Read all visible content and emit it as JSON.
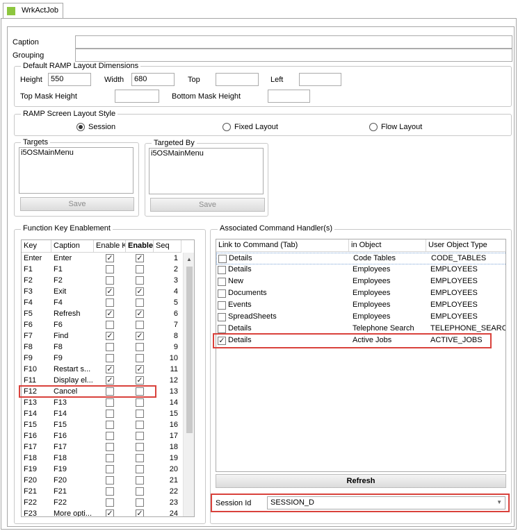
{
  "tab": {
    "label": "WrkActJob"
  },
  "caption": {
    "label": "Caption",
    "value": ""
  },
  "grouping": {
    "label": "Grouping",
    "value": ""
  },
  "dims": {
    "title": "Default RAMP Layout Dimensions",
    "height_label": "Height",
    "height": "550",
    "width_label": "Width",
    "width": "680",
    "top_label": "Top",
    "top": "",
    "left_label": "Left",
    "left": "",
    "topmask_label": "Top Mask Height",
    "topmask": "",
    "bottommask_label": "Bottom Mask Height",
    "bottommask": ""
  },
  "style": {
    "title": "RAMP Screen Layout Style",
    "options": [
      "Session",
      "Fixed Layout",
      "Flow Layout"
    ],
    "selected": "Session"
  },
  "targets": {
    "title": "Targets",
    "items": [
      "i5OSMainMenu"
    ],
    "save": "Save"
  },
  "targeted_by": {
    "title": "Targeted By",
    "items": [
      "i5OSMainMenu"
    ],
    "save": "Save"
  },
  "fke": {
    "title": "Function Key Enablement",
    "headers": [
      "Key",
      "Caption",
      "Enable Ke",
      "Enable",
      "Seq"
    ],
    "rows": [
      {
        "key": "Enter",
        "caption": "Enter",
        "a": true,
        "b": true,
        "seq": "1"
      },
      {
        "key": "F1",
        "caption": "F1",
        "a": false,
        "b": false,
        "seq": "2"
      },
      {
        "key": "F2",
        "caption": "F2",
        "a": false,
        "b": false,
        "seq": "3"
      },
      {
        "key": "F3",
        "caption": "Exit",
        "a": true,
        "b": true,
        "seq": "4"
      },
      {
        "key": "F4",
        "caption": "F4",
        "a": false,
        "b": false,
        "seq": "5"
      },
      {
        "key": "F5",
        "caption": "Refresh",
        "a": true,
        "b": true,
        "seq": "6"
      },
      {
        "key": "F6",
        "caption": "F6",
        "a": false,
        "b": false,
        "seq": "7"
      },
      {
        "key": "F7",
        "caption": "Find",
        "a": true,
        "b": true,
        "seq": "8"
      },
      {
        "key": "F8",
        "caption": "F8",
        "a": false,
        "b": false,
        "seq": "9"
      },
      {
        "key": "F9",
        "caption": "F9",
        "a": false,
        "b": false,
        "seq": "10"
      },
      {
        "key": "F10",
        "caption": "Restart s...",
        "a": true,
        "b": true,
        "seq": "11"
      },
      {
        "key": "F11",
        "caption": "Display el...",
        "a": true,
        "b": true,
        "seq": "12"
      },
      {
        "key": "F12",
        "caption": "Cancel",
        "a": false,
        "b": false,
        "seq": "13"
      },
      {
        "key": "F13",
        "caption": "F13",
        "a": false,
        "b": false,
        "seq": "14"
      },
      {
        "key": "F14",
        "caption": "F14",
        "a": false,
        "b": false,
        "seq": "15"
      },
      {
        "key": "F15",
        "caption": "F15",
        "a": false,
        "b": false,
        "seq": "16"
      },
      {
        "key": "F16",
        "caption": "F16",
        "a": false,
        "b": false,
        "seq": "17"
      },
      {
        "key": "F17",
        "caption": "F17",
        "a": false,
        "b": false,
        "seq": "18"
      },
      {
        "key": "F18",
        "caption": "F18",
        "a": false,
        "b": false,
        "seq": "19"
      },
      {
        "key": "F19",
        "caption": "F19",
        "a": false,
        "b": false,
        "seq": "20"
      },
      {
        "key": "F20",
        "caption": "F20",
        "a": false,
        "b": false,
        "seq": "21"
      },
      {
        "key": "F21",
        "caption": "F21",
        "a": false,
        "b": false,
        "seq": "22"
      },
      {
        "key": "F22",
        "caption": "F22",
        "a": false,
        "b": false,
        "seq": "23"
      },
      {
        "key": "F23",
        "caption": "More opti...",
        "a": true,
        "b": true,
        "seq": "24"
      }
    ]
  },
  "ach": {
    "title": "Associated Command Handler(s)",
    "headers": [
      "Link to Command (Tab)",
      "in Object",
      "User Object Type"
    ],
    "rows": [
      {
        "checked": false,
        "cmd": "Details",
        "obj": "Code Tables",
        "type": "CODE_TABLES"
      },
      {
        "checked": false,
        "cmd": "Details",
        "obj": "Employees",
        "type": "EMPLOYEES"
      },
      {
        "checked": false,
        "cmd": "New",
        "obj": "Employees",
        "type": "EMPLOYEES"
      },
      {
        "checked": false,
        "cmd": "Documents",
        "obj": "Employees",
        "type": "EMPLOYEES"
      },
      {
        "checked": false,
        "cmd": "Events",
        "obj": "Employees",
        "type": "EMPLOYEES"
      },
      {
        "checked": false,
        "cmd": "SpreadSheets",
        "obj": "Employees",
        "type": "EMPLOYEES"
      },
      {
        "checked": false,
        "cmd": "Details",
        "obj": "Telephone Search",
        "type": "TELEPHONE_SEARCH"
      },
      {
        "checked": true,
        "cmd": "Details",
        "obj": "Active Jobs",
        "type": "ACTIVE_JOBS"
      }
    ],
    "refresh": "Refresh"
  },
  "session": {
    "label": "Session Id",
    "value": "SESSION_D"
  },
  "colors": {
    "highlight": "#d9413b",
    "tab_icon": "#8dc63f"
  }
}
